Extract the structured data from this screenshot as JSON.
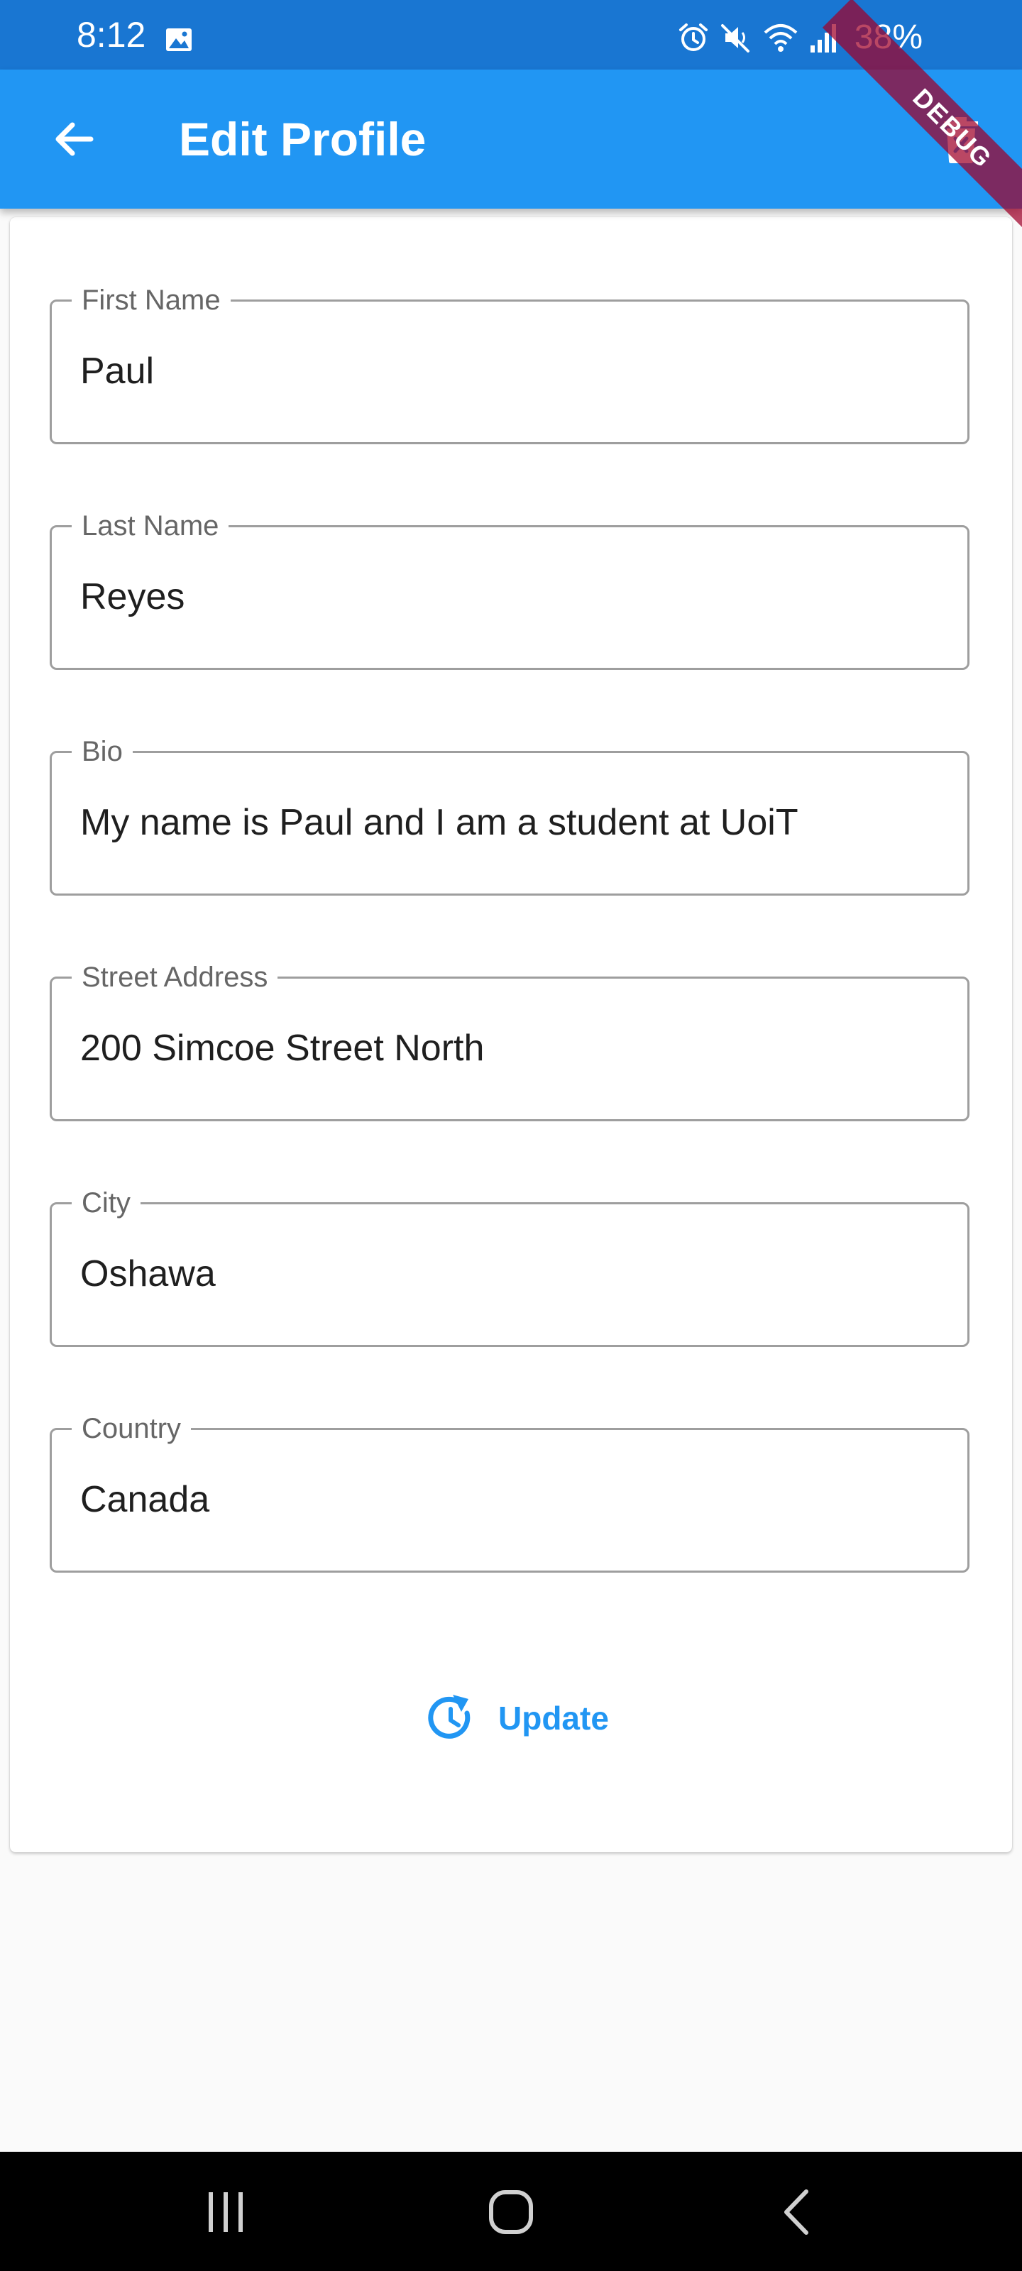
{
  "status_bar": {
    "time": "8:12",
    "battery": "38%",
    "icons": [
      "gallery-icon",
      "alarm-icon",
      "mute-icon",
      "wifi-icon",
      "signal-icon"
    ]
  },
  "app_bar": {
    "title": "Edit Profile",
    "back_icon": "arrow-back-icon",
    "delete_icon": "delete-forever-icon",
    "color": "#2196f3"
  },
  "debug_banner": "DEBUG",
  "form": {
    "fields": [
      {
        "label": "First Name",
        "value": "Paul"
      },
      {
        "label": "Last Name",
        "value": "Reyes"
      },
      {
        "label": "Bio",
        "value": "My name is Paul and I am a student at UoiT"
      },
      {
        "label": "Street Address",
        "value": "200 Simcoe Street North"
      },
      {
        "label": "City",
        "value": "Oshawa"
      },
      {
        "label": "Country",
        "value": "Canada"
      }
    ],
    "update_button": {
      "label": "Update",
      "icon": "update-icon"
    }
  },
  "nav_bar": {
    "icons": [
      "recent-apps-icon",
      "home-icon",
      "back-icon"
    ]
  }
}
